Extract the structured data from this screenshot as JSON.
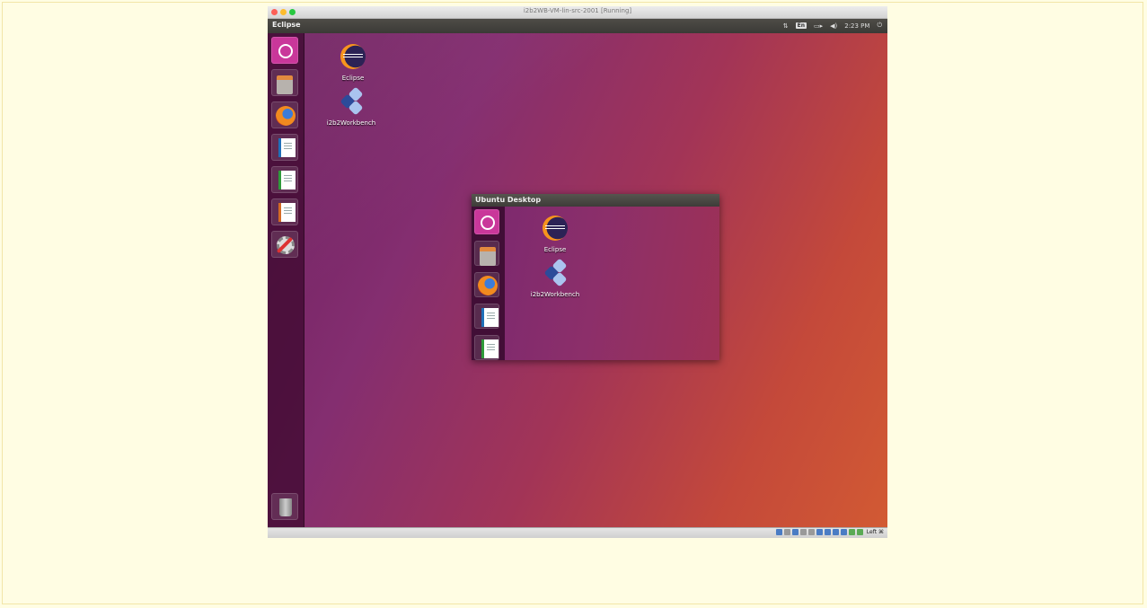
{
  "vm_window": {
    "title": "i2b2WB-VM-lin-src-2001 [Running]"
  },
  "panel": {
    "active_app": "Eclipse",
    "keyboard": "En",
    "time": "2:23 PM"
  },
  "desktop": {
    "icons": [
      {
        "label": "Eclipse",
        "icon": "eclipse-icon"
      },
      {
        "label": "i2b2Workbench",
        "icon": "i2b2-workbench-icon"
      }
    ]
  },
  "launcher": {
    "items": [
      "dash-icon",
      "files-icon",
      "firefox-icon",
      "writer-icon",
      "calc-icon",
      "impress-icon",
      "settings-icon"
    ],
    "trash": "trash-icon"
  },
  "preview_window": {
    "title": "Ubuntu Desktop",
    "icons": [
      {
        "label": "Eclipse"
      },
      {
        "label": "i2b2Workbench"
      }
    ]
  },
  "statusbar": {
    "host_key": "Left ⌘"
  },
  "colors": {
    "page_background": "#fffde3",
    "launcher": "#3c082d",
    "dash_button": "#c9379a"
  }
}
